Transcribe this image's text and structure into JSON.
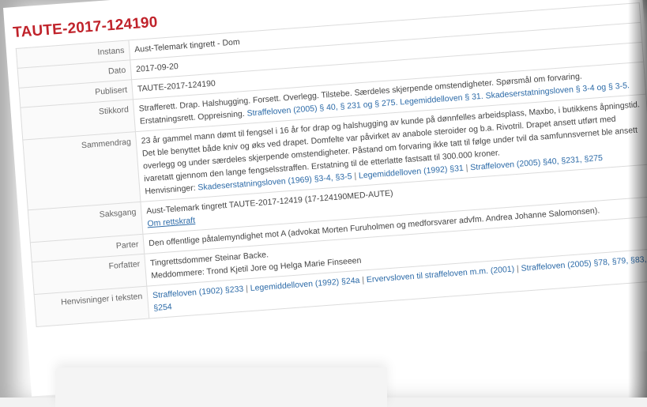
{
  "doc": {
    "title": "TAUTE-2017-124190",
    "rows": {
      "instans": {
        "label": "Instans",
        "value": "Aust-Telemark tingrett - Dom"
      },
      "dato": {
        "label": "Dato",
        "value": "2017-09-20"
      },
      "publisert": {
        "label": "Publisert",
        "value": "TAUTE-2017-124190"
      },
      "stikkord": {
        "label": "Stikkord",
        "text": "Strafferett. Drap. Halshugging. Forsett. Overlegg. Tilstebe. Særdeles skjerpende omstendigheter. Spørsmål om forvaring. Erstatningsrett. Oppreisning.",
        "links": [
          "Straffeloven (2005) § 40, § 231 og § 275.",
          "Legemiddelloven § 31.",
          "Skadeserstatningsloven § 3-4 og § 3-5."
        ]
      },
      "sammendrag": {
        "label": "Sammendrag",
        "text": "23 år gammel mann dømt til fengsel i 16 år for drap og halshugging av kunde på dønnfelles arbeidsplass, Maxbo, i butikkens åpningstid. Det ble benyttet både kniv og øks ved drapet. Domfelte var påvirket av anabole steroider og b.a. Rivotril. Drapet ansett utført med overlegg og under særdeles skjerpende omstendigheter. Påstand om forvaring ikke tatt til følge under tvil da samfunnsvernet ble ansett ivaretatt gjennom den lange fengselsstraffen. Erstatning til de etterlatte fastsatt til 300.000 kroner.",
        "ref_label": "Henvisninger:",
        "ref_links": [
          "Skadeserstatningsloven (1969) §3-4, §3-5",
          "Legemiddelloven (1992) §31",
          "Straffeloven (2005) §40, §231, §275"
        ]
      },
      "saksgang": {
        "label": "Saksgang",
        "text": "Aust-Telemark tingrett TAUTE-2017-12419 (17-124190MED-AUTE)",
        "link": "Om rettskraft"
      },
      "parter": {
        "label": "Parter",
        "text": "Den offentlige påtalemyndighet mot A (advokat Morten Furuholmen og medforsvarer advfm. Andrea Johanne Salomonsen)."
      },
      "forfatter": {
        "label": "Forfatter",
        "line1": "Tingrettsdommer Steinar Backe.",
        "line2": "Meddommere: Trond Kjetil Jore og Helga Marie Finseeen"
      },
      "lovhenvisninger": {
        "label": "Henvisninger i teksten",
        "links": [
          "Straffeloven (1902) §233",
          "Legemiddelloven (1992) §24a",
          "Ervervsloven til straffeloven m.m. (2001)",
          "Straffeloven (2005) §78, §79, §83, §254"
        ]
      }
    }
  }
}
